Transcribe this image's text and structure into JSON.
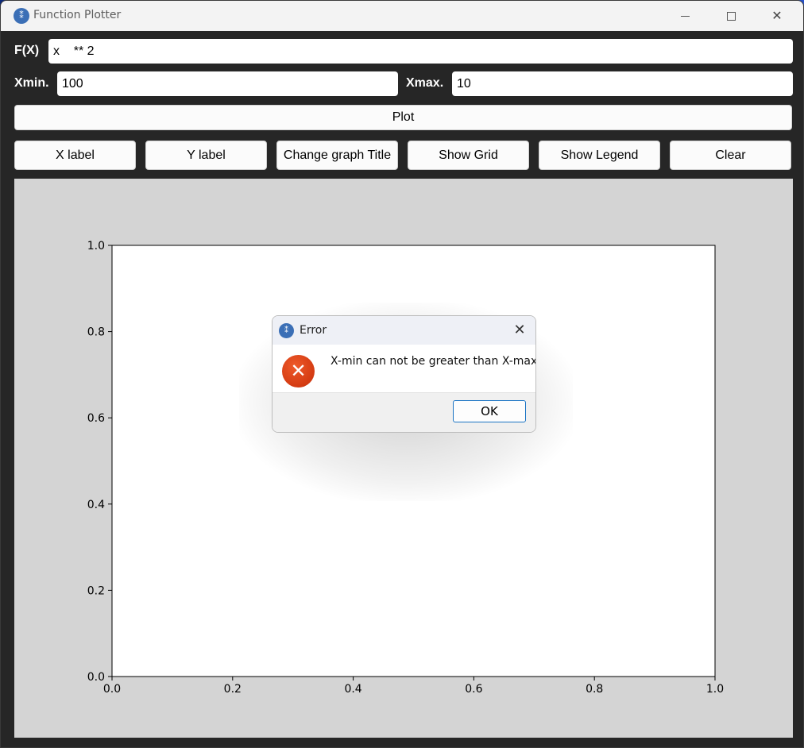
{
  "window": {
    "title": "Function Plotter",
    "icon": "calculator-icon",
    "controls": {
      "minimize": "minimize-icon",
      "maximize": "maximize-icon",
      "close": "close-icon"
    }
  },
  "form": {
    "fx_label": "F(X)",
    "fx_value": "x    ** 2",
    "xmin_label": "Xmin.",
    "xmin_value": "100",
    "xmax_label": "Xmax.",
    "xmax_value": "10",
    "plot_button": "Plot"
  },
  "toolbar": {
    "buttons": [
      "X label",
      "Y label",
      "Change graph Title",
      "Show Grid",
      "Show Legend",
      "Clear"
    ]
  },
  "chart_data": {
    "type": "line",
    "title": "",
    "xlabel": "",
    "ylabel": "",
    "xlim": [
      0.0,
      1.0
    ],
    "ylim": [
      0.0,
      1.0
    ],
    "x_ticks": [
      "0.0",
      "0.2",
      "0.4",
      "0.6",
      "0.8",
      "1.0"
    ],
    "y_ticks": [
      "0.0",
      "0.2",
      "0.4",
      "0.6",
      "0.8",
      "1.0"
    ],
    "series": [],
    "grid": false,
    "background_color": "#d4d4d4"
  },
  "dialog": {
    "title": "Error",
    "icon": "error-icon",
    "message": "X-min can not be greater than X-max",
    "ok_button": "OK"
  },
  "colors": {
    "window_bg": "#262626",
    "titlebar_bg": "#f3f3f3",
    "error_red": "#d43b12",
    "accent": "#1b74c4"
  }
}
